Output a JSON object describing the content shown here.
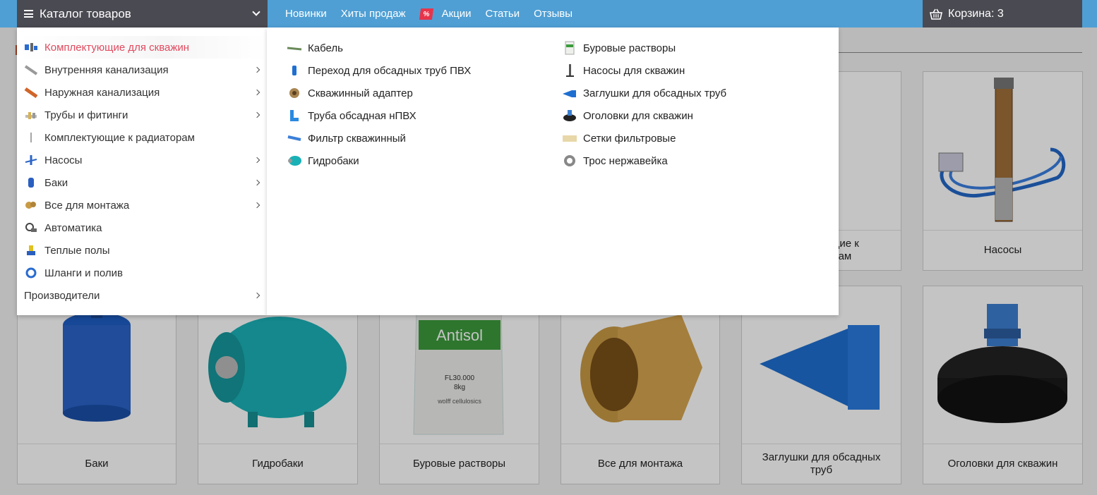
{
  "header": {
    "catalog_label": "Каталог товаров",
    "nav": [
      "Новинки",
      "Хиты продаж",
      "Акции",
      "Статьи",
      "Отзывы"
    ],
    "sale_badge": "%",
    "cart_label": "Корзина: 3"
  },
  "menu": {
    "items": [
      {
        "label": "Комплектующие для скважин",
        "icon": "well-parts-icon",
        "active": true,
        "has_sub": false
      },
      {
        "label": "Внутренняя канализация",
        "icon": "grey-pipe-icon",
        "has_sub": true
      },
      {
        "label": "Наружная канализация",
        "icon": "orange-pipe-icon",
        "has_sub": true
      },
      {
        "label": "Трубы и фитинги",
        "icon": "fittings-icon",
        "has_sub": true
      },
      {
        "label": "Комплектующие к радиаторам",
        "icon": "radiator-key-icon",
        "has_sub": false
      },
      {
        "label": "Насосы",
        "icon": "pump-icon",
        "has_sub": true
      },
      {
        "label": "Баки",
        "icon": "tank-icon",
        "has_sub": true
      },
      {
        "label": "Все для монтажа",
        "icon": "mounting-icon",
        "has_sub": true
      },
      {
        "label": "Автоматика",
        "icon": "automation-icon",
        "has_sub": false
      },
      {
        "label": "Теплые полы",
        "icon": "warm-floor-icon",
        "has_sub": false
      },
      {
        "label": "Шланги и полив",
        "icon": "hose-icon",
        "has_sub": false
      }
    ],
    "producers_label": "Производители"
  },
  "submenu": {
    "col1": [
      {
        "label": "Кабель",
        "icon": "cable-icon"
      },
      {
        "label": "Переход для обсадных труб ПВХ",
        "icon": "pvc-adapter-icon"
      },
      {
        "label": "Скважинный адаптер",
        "icon": "well-adapter-icon"
      },
      {
        "label": "Труба обсадная нПВХ",
        "icon": "casing-pipe-icon"
      },
      {
        "label": "Фильтр скважинный",
        "icon": "well-filter-icon"
      },
      {
        "label": "Гидробаки",
        "icon": "hydro-tank-icon"
      }
    ],
    "col2": [
      {
        "label": "Буровые растворы",
        "icon": "drilling-mud-icon"
      },
      {
        "label": "Насосы для скважин",
        "icon": "well-pump-icon"
      },
      {
        "label": "Заглушки для обсадных труб",
        "icon": "pipe-cap-icon"
      },
      {
        "label": "Оголовки для скважин",
        "icon": "well-head-icon"
      },
      {
        "label": "Сетки фильтровые",
        "icon": "filter-mesh-icon"
      },
      {
        "label": "Трос нержавейка",
        "icon": "steel-rope-icon"
      }
    ]
  },
  "cards": {
    "row1_partial_caption": "щие к\nам",
    "row1_pumps": "Насосы",
    "row2": [
      "Баки",
      "Гидробаки",
      "Буровые растворы",
      "Все для монтажа",
      "Заглушки для обсадных труб",
      "Оголовки для скважин"
    ],
    "antisol_brand": "Antisol",
    "antisol_code": "FL30.000",
    "antisol_weight": "8kg",
    "antisol_maker": "wolff cellulosics"
  },
  "colors": {
    "topbar": "#4f9fd4",
    "dark": "#4a4a52",
    "accent": "#e04a5f"
  }
}
